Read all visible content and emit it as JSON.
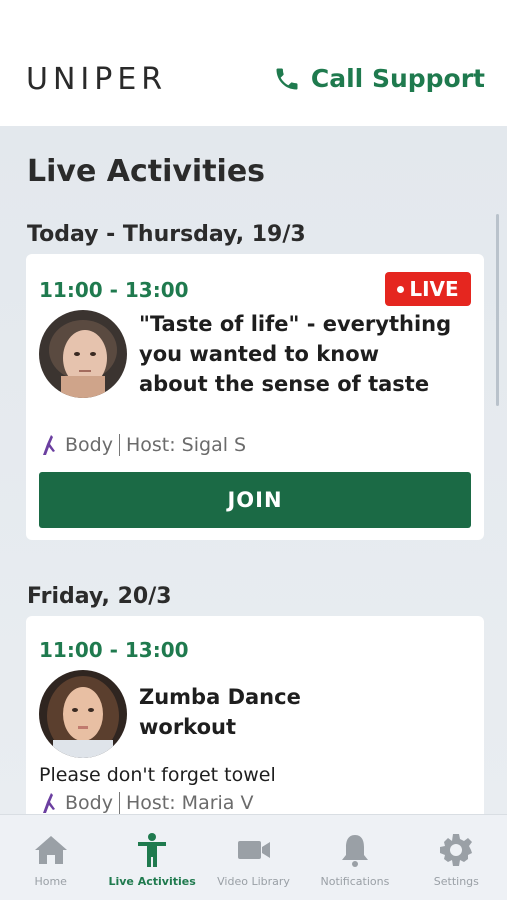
{
  "header": {
    "logo_text": "UNIPER",
    "call_support_label": "Call Support",
    "call_icon": "phone-icon"
  },
  "page": {
    "title": "Live Activities"
  },
  "days": [
    {
      "label": "Today - Thursday, 19/3",
      "activity": {
        "time": "11:00 - 13:00",
        "live_label": "LIVE",
        "title_lines": [
          "\"Taste of life\" - everything",
          "you wanted to know",
          "about the sense of taste"
        ],
        "category": "Body",
        "host": "Host: Sigal S",
        "join_label": "JOIN"
      }
    },
    {
      "label": "Friday, 20/3",
      "activity": {
        "time": "11:00 - 13:00",
        "title_lines": [
          "Zumba Dance",
          "workout"
        ],
        "note": "Please don't forget towel",
        "category": "Body",
        "host": "Host: Maria V"
      }
    }
  ],
  "nav": {
    "items": [
      {
        "label": "Home",
        "icon": "home-icon"
      },
      {
        "label": "Live Activities",
        "icon": "person-icon"
      },
      {
        "label": "Video Library",
        "icon": "video-camera-icon"
      },
      {
        "label": "Notifications",
        "icon": "bell-icon"
      },
      {
        "label": "Settings",
        "icon": "gear-icon"
      }
    ],
    "active_index": 1
  },
  "colors": {
    "brand_green": "#1f7a4e",
    "join_green": "#1b6a45",
    "live_red": "#e5261f",
    "category_icon_purple": "#6b3fa0"
  }
}
